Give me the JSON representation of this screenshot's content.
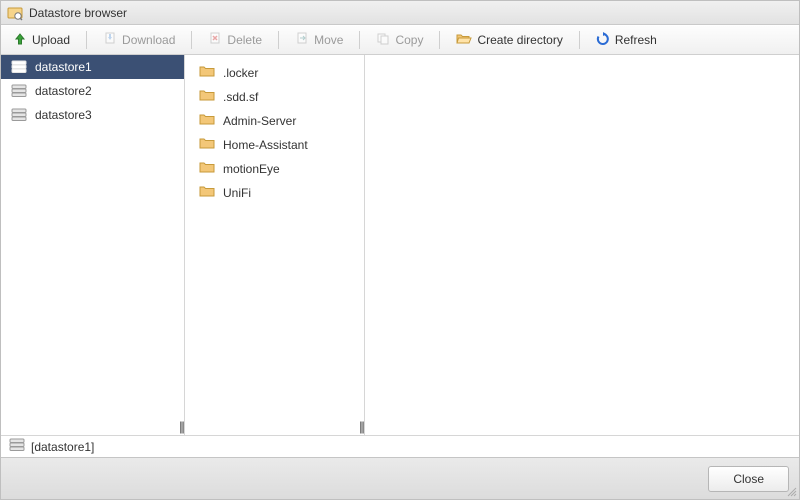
{
  "window": {
    "title": "Datastore browser"
  },
  "toolbar": {
    "upload": "Upload",
    "download": "Download",
    "delete": "Delete",
    "move": "Move",
    "copy": "Copy",
    "create_directory": "Create directory",
    "refresh": "Refresh"
  },
  "sidebar": {
    "items": [
      {
        "label": "datastore1",
        "selected": true
      },
      {
        "label": "datastore2",
        "selected": false
      },
      {
        "label": "datastore3",
        "selected": false
      }
    ]
  },
  "folders": [
    {
      "label": ".locker"
    },
    {
      "label": ".sdd.sf"
    },
    {
      "label": "Admin-Server"
    },
    {
      "label": "Home-Assistant"
    },
    {
      "label": "motionEye"
    },
    {
      "label": "UniFi"
    }
  ],
  "pathbar": {
    "text": "[datastore1]"
  },
  "footer": {
    "close": "Close"
  },
  "colors": {
    "selection": "#3b5074",
    "folder": "#f3c778",
    "folder_open": "#f3c778"
  }
}
